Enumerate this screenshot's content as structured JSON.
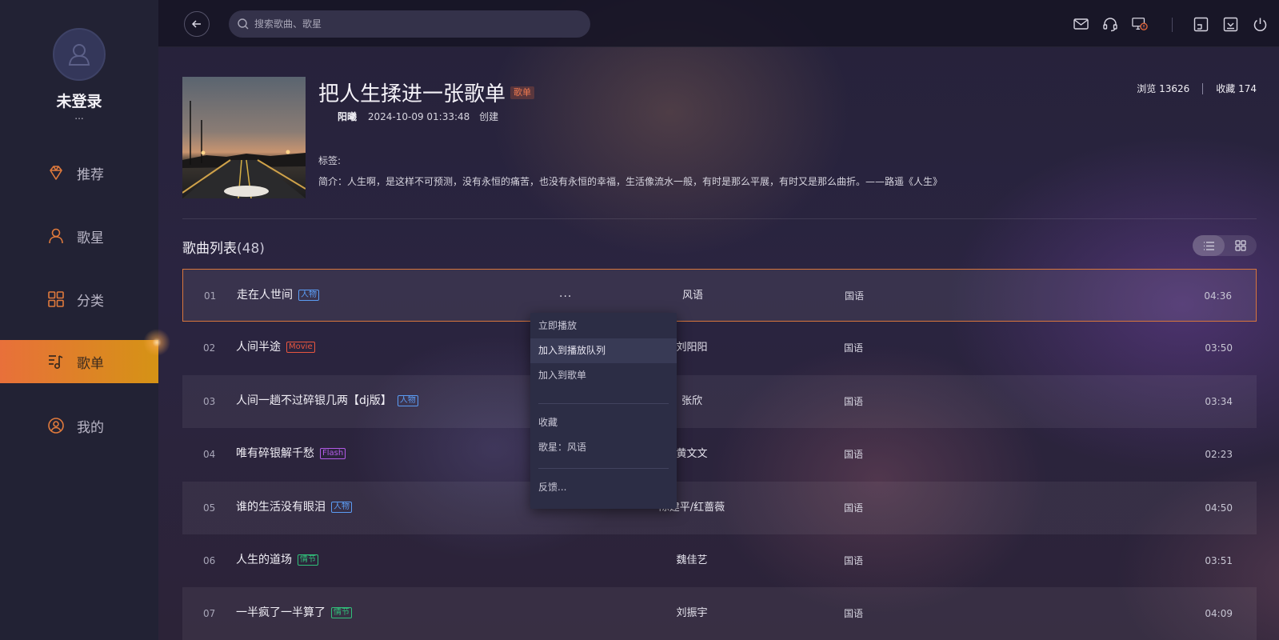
{
  "sidebar": {
    "user_name": "未登录",
    "user_more": "...",
    "items": [
      {
        "label": "推荐",
        "icon": "diamond-icon"
      },
      {
        "label": "歌星",
        "icon": "singer-icon"
      },
      {
        "label": "分类",
        "icon": "grid-icon"
      },
      {
        "label": "歌单",
        "icon": "playlist-icon",
        "active": true
      },
      {
        "label": "我的",
        "icon": "profile-icon"
      }
    ]
  },
  "topbar": {
    "search_placeholder": "搜索歌曲、歌星",
    "icons": [
      "mail-icon",
      "headset-icon",
      "screen-alert-icon",
      "minimize-window-icon",
      "download-box-icon",
      "power-icon"
    ]
  },
  "playlist": {
    "title": "把人生揉进一张歌单",
    "badge": "歌单",
    "creator": "阳曦",
    "created_at": "2024-10-09 01:33:48",
    "created_label": "创建",
    "tags_label": "标签:",
    "description": "简介：人生啊，是这样不可预测，没有永恒的痛苦，也没有永恒的幸福，生活像流水一般，有时是那么平展，有时又是那么曲折。——路遥《人生》",
    "views_label": "浏览 13626",
    "favorites_label": "收藏 174"
  },
  "song_list": {
    "title": "歌曲列表",
    "count": "(48)",
    "songs": [
      {
        "num": "01",
        "title": "走在人世间",
        "tag": "人物",
        "tag_color": "blue",
        "artist": "风语",
        "lang": "国语",
        "duration": "04:36"
      },
      {
        "num": "02",
        "title": "人间半途",
        "tag": "Movie",
        "tag_color": "red",
        "artist": "刘阳阳",
        "lang": "国语",
        "duration": "03:50"
      },
      {
        "num": "03",
        "title": "人间一趟不过碎银几两【dj版】",
        "tag": "人物",
        "tag_color": "blue",
        "artist": "张欣",
        "lang": "国语",
        "duration": "03:34"
      },
      {
        "num": "04",
        "title": "唯有碎银解千愁",
        "tag": "Flash",
        "tag_color": "purple",
        "artist": "黄文文",
        "lang": "国语",
        "duration": "02:23"
      },
      {
        "num": "05",
        "title": "谁的生活没有眼泪",
        "tag": "人物",
        "tag_color": "blue",
        "artist": "陈建平/红蔷薇",
        "lang": "国语",
        "duration": "04:50"
      },
      {
        "num": "06",
        "title": "人生的道场",
        "tag": "情节",
        "tag_color": "green",
        "artist": "魏佳艺",
        "lang": "国语",
        "duration": "03:51"
      },
      {
        "num": "07",
        "title": "一半疯了一半算了",
        "tag": "情节",
        "tag_color": "green",
        "artist": "刘振宇",
        "lang": "国语",
        "duration": "04:09"
      }
    ],
    "more_label": "..."
  },
  "context_menu": {
    "items": [
      "立即播放",
      "加入到播放队列",
      "加入到歌单",
      "收藏",
      "歌星：风语",
      "反馈..."
    ]
  }
}
